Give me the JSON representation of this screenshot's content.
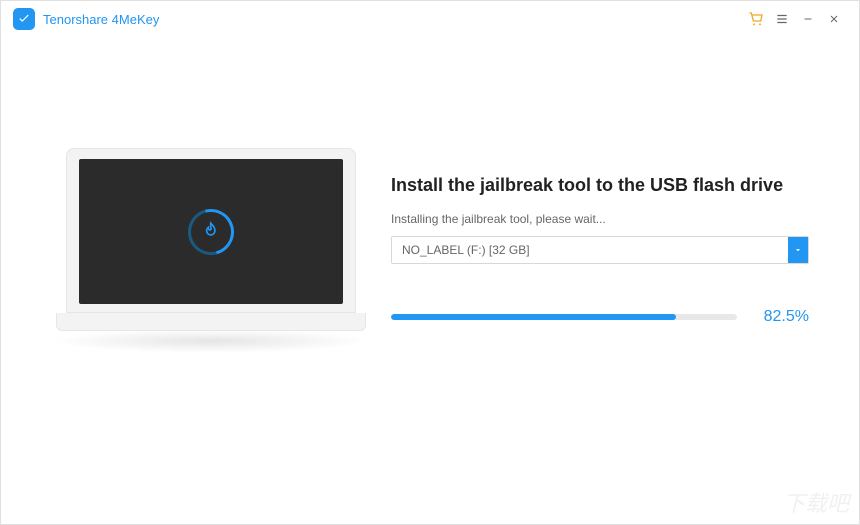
{
  "app": {
    "title": "Tenorshare 4MeKey"
  },
  "main": {
    "heading": "Install the jailbreak tool to the USB flash drive",
    "status": "Installing the jailbreak tool, please wait...",
    "drive": {
      "selected": "NO_LABEL (F:) [32 GB]"
    },
    "progress": {
      "percent": 82.5,
      "label": "82.5%"
    }
  },
  "colors": {
    "accent": "#2196f3",
    "cart": "#f5a623"
  }
}
